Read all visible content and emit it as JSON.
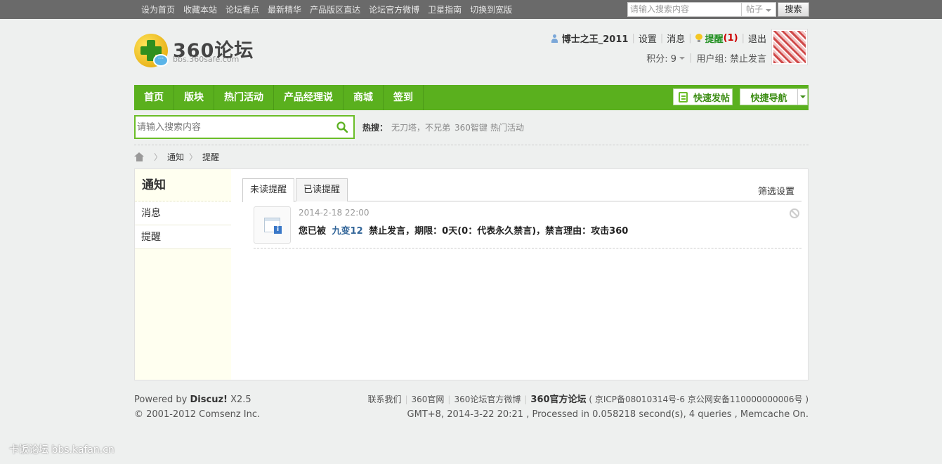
{
  "topbar": {
    "links": [
      "设为首页",
      "收藏本站",
      "论坛看点",
      "最新精华",
      "产品版区直达",
      "论坛官方微博",
      "卫星指南",
      "切换到宽版"
    ],
    "search_placeholder": "请输入搜索内容",
    "search_scope": "帖子",
    "search_button": "搜索"
  },
  "logo": {
    "name": "360论坛",
    "sub": "bbs.360safe.com"
  },
  "user": {
    "name": "博士之王_2011",
    "settings": "设置",
    "messages": "消息",
    "remind": "提醒",
    "remind_count": "(1)",
    "logout": "退出",
    "points": "积分: 9",
    "group": "用户组: 禁止发言"
  },
  "mainnav": {
    "items": [
      "首页",
      "版块",
      "热门活动",
      "产品经理说",
      "商城",
      "签到"
    ],
    "quick_post": "快速发帖",
    "quick_nav": "快捷导航"
  },
  "search": {
    "placeholder": "请输入搜索内容",
    "hot_label": "热搜：",
    "hot_items": [
      "无刀塔，不兄弟",
      "360智键",
      "热门活动"
    ]
  },
  "breadcrumb": {
    "items": [
      "通知",
      "提醒"
    ]
  },
  "sidebar": {
    "title": "通知",
    "items": [
      "消息",
      "提醒"
    ]
  },
  "tabs": {
    "items": [
      "未读提醒",
      "已读提醒"
    ],
    "filter": "筛选设置"
  },
  "notification": {
    "time": "2014-2-18 22:00",
    "prefix": "您已被",
    "actor": "九变12",
    "text": "禁止发言，期限：0天(0：代表永久禁言)，禁言理由：攻击360"
  },
  "footer": {
    "powered_prefix": "Powered by",
    "powered_name": "Discuz!",
    "powered_version": "X2.5",
    "copyright": "© 2001-2012 Comsenz Inc.",
    "links": [
      "联系我们",
      "360官网",
      "360论坛官方微博"
    ],
    "site_name": "360官方论坛",
    "icp": "( 京ICP备08010314号-6 京公网安备110000000006号 )",
    "stats": "GMT+8, 2014-3-22 20:21 , Processed in 0.058218 second(s), 4 queries , Memcache On."
  },
  "watermark": "卡饭论坛 bbs.kafan.cn"
}
